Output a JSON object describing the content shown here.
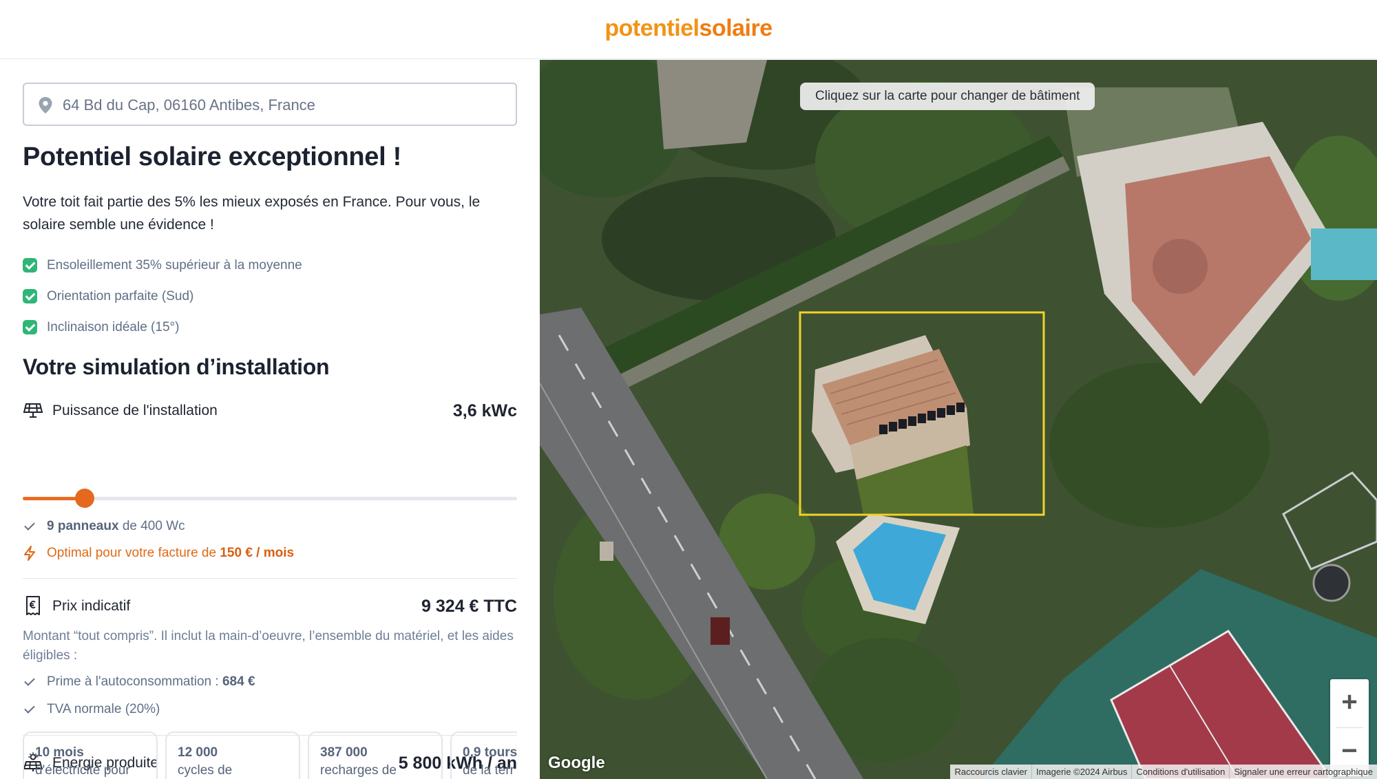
{
  "header": {
    "logo_part1": "potentiel",
    "logo_part2": "solaire"
  },
  "address": {
    "icon": "map-pin-icon",
    "value": "64 Bd du Cap, 06160 Antibes, France"
  },
  "result": {
    "title": "Potentiel solaire exceptionnel !",
    "intro": "Votre toit fait partie des 5% les mieux exposés en France. Pour vous, le solaire semble une évidence !",
    "checks": [
      "Ensoleillement 35% supérieur à la moyenne",
      "Orientation parfaite (Sud)",
      "Inclinaison idéale (15°)"
    ]
  },
  "simulation": {
    "title": "Votre simulation d’installation",
    "power": {
      "label": "Puissance de l'installation",
      "value": "3,6 kWc",
      "slider_fraction": 0.125,
      "panels_bold": "9 panneaux",
      "panels_rest": "de 400 Wc",
      "optimal_text": "Optimal pour votre facture de",
      "optimal_value": "150 € / mois"
    },
    "price": {
      "label": "Prix indicatif",
      "value": "9 324 € TTC",
      "note": "Montant “tout compris”. Il inclut la main-d’oeuvre, l’ensemble du matériel, et les aides éligibles :",
      "prime_label": "Prime à l'autoconsommation :",
      "prime_value": "684 €",
      "tva": "TVA normale (20%)"
    },
    "energy": {
      "label": "Energie produite",
      "value": "5 800 kWh / an",
      "cards": [
        {
          "bold": "10 mois",
          "text": "d'électricité pour"
        },
        {
          "bold": "12 000",
          "text": "cycles de"
        },
        {
          "bold": "387 000",
          "text": "recharges de"
        },
        {
          "bold": "0,9 tours",
          "text": "de la terr"
        }
      ]
    }
  },
  "map": {
    "tip": "Cliquez sur la carte pour changer de bâtiment",
    "zoom_in": "+",
    "zoom_out": "−",
    "google": "Google",
    "attributions": [
      "Raccourcis clavier",
      "Imagerie ©2024 Airbus",
      "Conditions d'utilisation",
      "Signaler une erreur cartographique"
    ],
    "selection_color": "#f2d22a"
  },
  "colors": {
    "brand": "#f29316",
    "accent": "#ea6b21",
    "check_green": "#2fb677"
  }
}
